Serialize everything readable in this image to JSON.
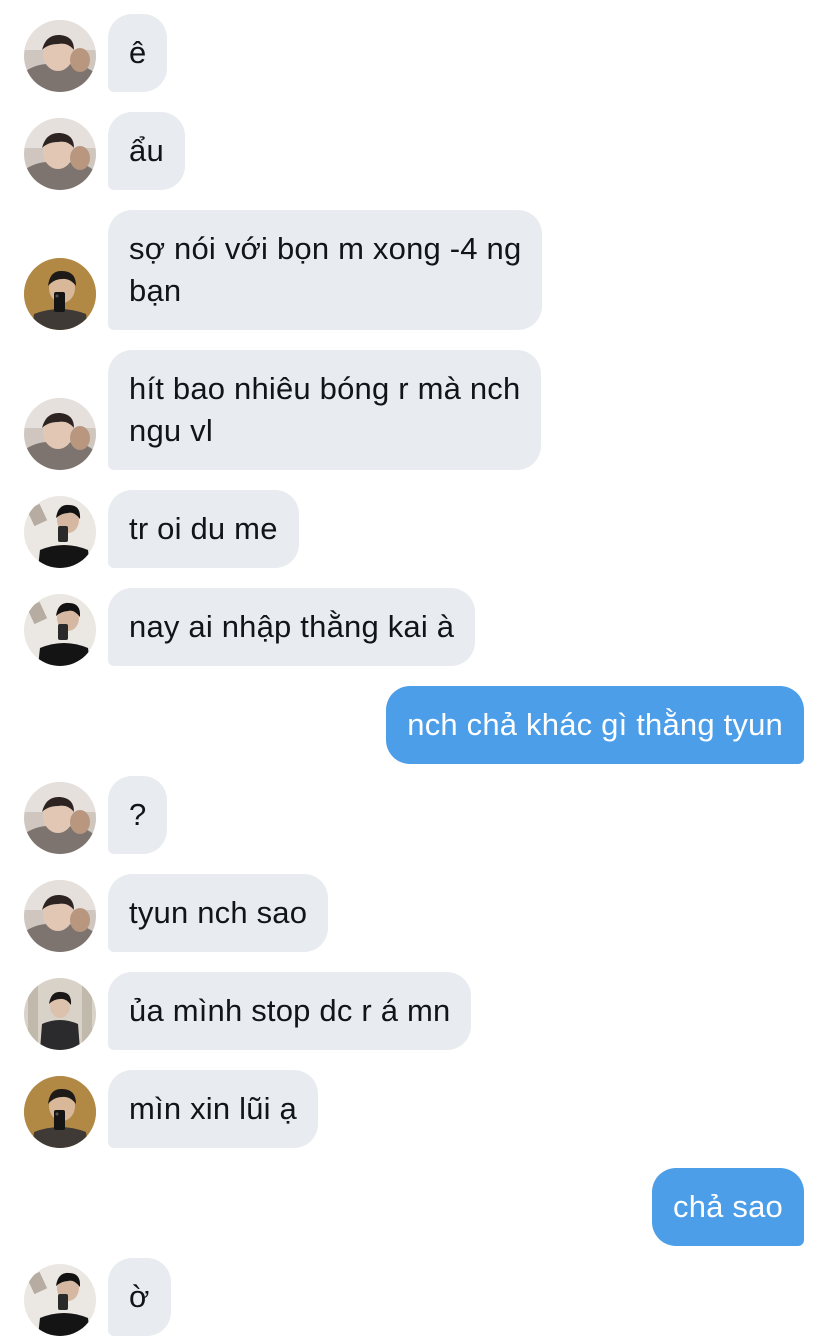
{
  "colors": {
    "incoming_bubble": "#e8ebef",
    "outgoing_bubble": "#4c9ee8",
    "incoming_text": "#111418",
    "outgoing_text": "#ffffff"
  },
  "messages": [
    {
      "sender": "user-a",
      "direction": "incoming",
      "text": "ê"
    },
    {
      "sender": "user-a",
      "direction": "incoming",
      "text": "ẩu"
    },
    {
      "sender": "user-b",
      "direction": "incoming",
      "text": "sợ nói với bọn m xong -4 ng\nbạn"
    },
    {
      "sender": "user-a",
      "direction": "incoming",
      "text": "hít bao nhiêu bóng r mà nch\nngu vl"
    },
    {
      "sender": "user-c",
      "direction": "incoming",
      "text": "tr oi du me"
    },
    {
      "sender": "user-c",
      "direction": "incoming",
      "text": "nay ai nhập thằng kai à"
    },
    {
      "sender": "me",
      "direction": "outgoing",
      "text": "nch chả khác gì thằng tyun"
    },
    {
      "sender": "user-a",
      "direction": "incoming",
      "text": "?"
    },
    {
      "sender": "user-a",
      "direction": "incoming",
      "text": "tyun nch sao"
    },
    {
      "sender": "user-d",
      "direction": "incoming",
      "text": "ủa mình stop dc r á mn"
    },
    {
      "sender": "user-b",
      "direction": "incoming",
      "text": "mìn xin lũi ạ"
    },
    {
      "sender": "me",
      "direction": "outgoing",
      "text": "chả sao"
    },
    {
      "sender": "user-c",
      "direction": "incoming",
      "text": "ờ"
    }
  ]
}
